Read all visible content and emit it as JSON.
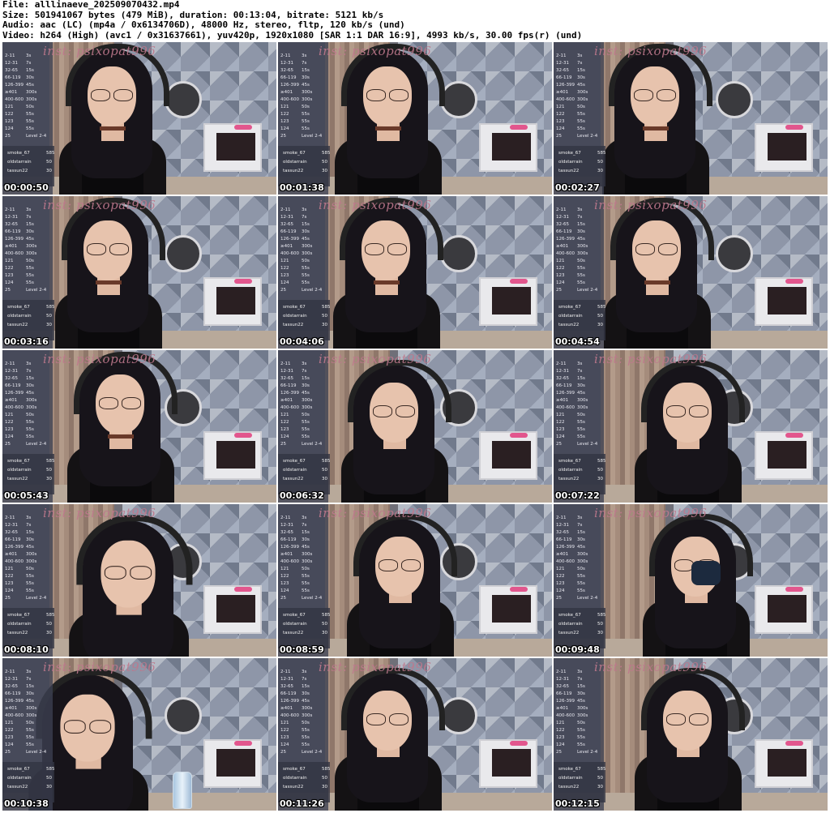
{
  "header": {
    "file": "File: alllinaeve_202509070432.mp4",
    "size": "Size: 501941067 bytes (479 MiB), duration: 00:13:04, bitrate: 5121 kb/s",
    "audio": "Audio: aac (LC) (mp4a / 0x6134706D), 48000 Hz, stereo, fltp, 120 kb/s (und)",
    "video": "Video: h264 (High) (avc1 / 0x31637661), yuv420p, 1920x1080 [SAR 1:1 DAR 16:9], 4993 kb/s, 30.00 fps(r) (und)"
  },
  "overlay": {
    "watermark": "inst: psixopat996",
    "menu": [
      {
        "range": "2-11",
        "val": "3s"
      },
      {
        "range": "12-31",
        "val": "7s"
      },
      {
        "range": "32-65",
        "val": "15s"
      },
      {
        "range": "66-119",
        "val": "30s"
      },
      {
        "range": "126-399",
        "val": "45s"
      },
      {
        "range": "≥401",
        "val": "300s"
      },
      {
        "range": "400-600",
        "val": "300s"
      },
      {
        "range": "121",
        "val": "50s"
      },
      {
        "range": "122",
        "val": "55s"
      },
      {
        "range": "123",
        "val": "55s"
      },
      {
        "range": "124",
        "val": "55s"
      },
      {
        "range": "25",
        "val": "Level 2-4"
      }
    ],
    "leaderboard": [
      {
        "name": "smoke_67",
        "amount": "585"
      },
      {
        "name": "oldstarrain",
        "amount": "50"
      },
      {
        "name": "tassun22",
        "amount": "30"
      }
    ]
  },
  "thumbnails": [
    {
      "time": "00:00:50",
      "pose": "head-down"
    },
    {
      "time": "00:01:38",
      "pose": "head-down"
    },
    {
      "time": "00:02:27",
      "pose": "head-down"
    },
    {
      "time": "00:03:16",
      "pose": "head-down"
    },
    {
      "time": "00:04:06",
      "pose": "head-down"
    },
    {
      "time": "00:04:54",
      "pose": "head-down"
    },
    {
      "time": "00:05:43",
      "pose": "looking-down"
    },
    {
      "time": "00:06:32",
      "pose": "facing"
    },
    {
      "time": "00:07:22",
      "pose": "facing"
    },
    {
      "time": "00:08:10",
      "pose": "close"
    },
    {
      "time": "00:08:59",
      "pose": "facing"
    },
    {
      "time": "00:09:48",
      "pose": "drinking"
    },
    {
      "time": "00:10:38",
      "pose": "close-bottle"
    },
    {
      "time": "00:11:26",
      "pose": "facing"
    },
    {
      "time": "00:12:15",
      "pose": "facing"
    }
  ],
  "colors": {
    "background": "#ffffff",
    "timestamp_text": "#ffffff",
    "watermark": "#be788c"
  }
}
